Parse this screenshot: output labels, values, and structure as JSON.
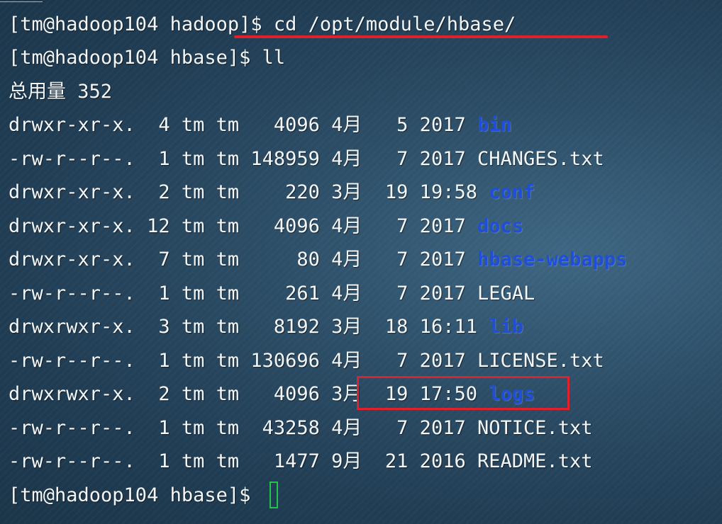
{
  "terminal": {
    "prompt_lines": [
      {
        "prompt": "[tm@hadoop104 hadoop]$ ",
        "command": "cd /opt/module/hbase/"
      },
      {
        "prompt": "[tm@hadoop104 hbase]$ ",
        "command": "ll"
      },
      {
        "prompt": "[tm@hadoop104 hbase]$ ",
        "command": ""
      }
    ],
    "total_line": "总用量 352",
    "listing": [
      {
        "meta": "drwxr-xr-x.  4 tm tm   4096 4月   5 2017 ",
        "name": "bin",
        "kind": "dir"
      },
      {
        "meta": "-rw-r--r--.  1 tm tm 148959 4月   7 2017 ",
        "name": "CHANGES.txt",
        "kind": "file"
      },
      {
        "meta": "drwxr-xr-x.  2 tm tm    220 3月  19 19:58 ",
        "name": "conf",
        "kind": "dir"
      },
      {
        "meta": "drwxr-xr-x. 12 tm tm   4096 4月   7 2017 ",
        "name": "docs",
        "kind": "dir"
      },
      {
        "meta": "drwxr-xr-x.  7 tm tm     80 4月   7 2017 ",
        "name": "hbase-webapps",
        "kind": "dir"
      },
      {
        "meta": "-rw-r--r--.  1 tm tm    261 4月   7 2017 ",
        "name": "LEGAL",
        "kind": "file"
      },
      {
        "meta": "drwxrwxr-x.  3 tm tm   8192 3月  18 16:11 ",
        "name": "lib",
        "kind": "dir"
      },
      {
        "meta": "-rw-r--r--.  1 tm tm 130696 4月   7 2017 ",
        "name": "LICENSE.txt",
        "kind": "file"
      },
      {
        "meta": "drwxrwxr-x.  2 tm tm   4096 3月  19 17:50 ",
        "name": "logs",
        "kind": "dir"
      },
      {
        "meta": "-rw-r--r--.  1 tm tm  43258 4月   7 2017 ",
        "name": "NOTICE.txt",
        "kind": "file"
      },
      {
        "meta": "-rw-r--r--.  1 tm tm   1477 9月  21 2016 ",
        "name": "README.txt",
        "kind": "file"
      }
    ]
  },
  "colors": {
    "directory": "#1f4fd8",
    "text": "#f4f6f8",
    "annotation": "#e0202a",
    "cursor": "#23c44a"
  }
}
